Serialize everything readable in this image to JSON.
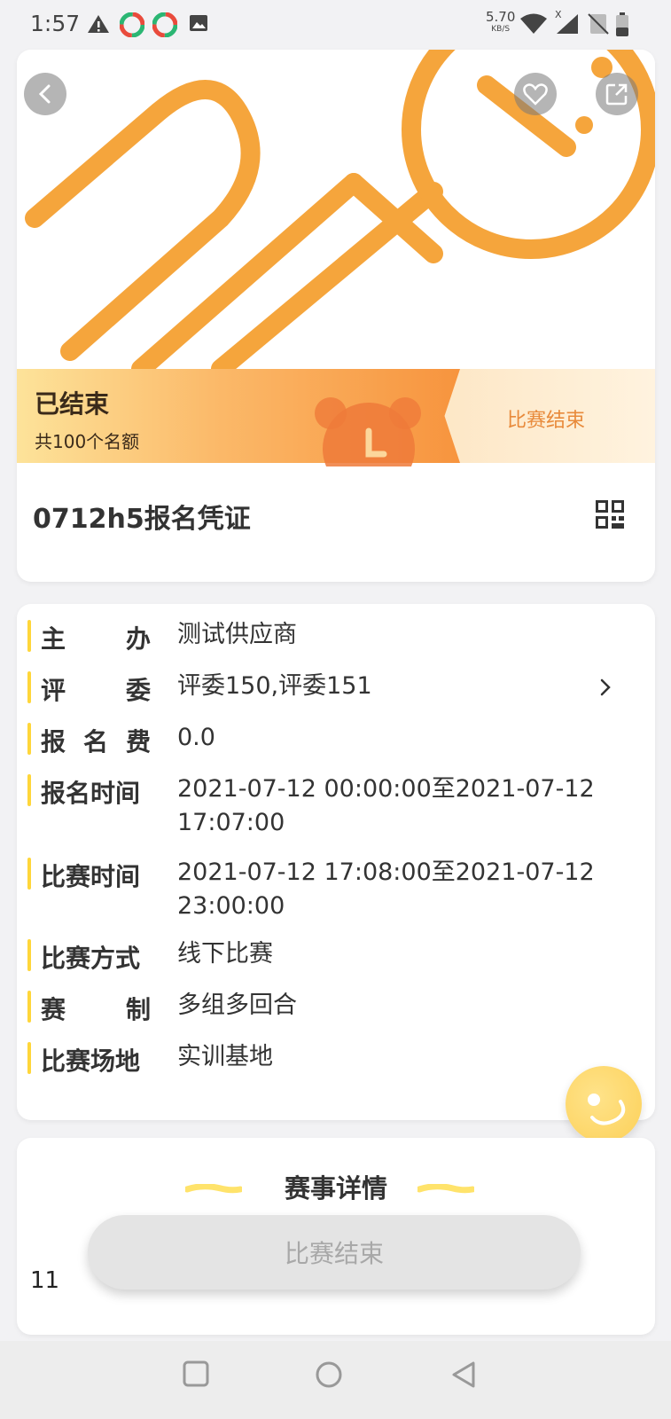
{
  "status_bar": {
    "time": "1:57",
    "speed_value": "5.70",
    "speed_unit": "KB/S",
    "signal_label": "X"
  },
  "event": {
    "status_title": "已结束",
    "quota_text": "共100个名额",
    "status_badge": "比赛结束",
    "certificate_title": "0712h5报名凭证"
  },
  "info": [
    {
      "label": [
        "主",
        "办"
      ],
      "value": "测试供应商"
    },
    {
      "label": [
        "评",
        "委"
      ],
      "value": "评委150,评委151"
    },
    {
      "label": [
        "报",
        "名",
        "费"
      ],
      "value": "0.0"
    },
    {
      "label": [
        "报名时间"
      ],
      "value": "2021-07-12 00:00:00至2021-07-12 17:07:00"
    },
    {
      "label": [
        "比赛时间"
      ],
      "value": "2021-07-12 17:08:00至2021-07-12 23:00:00"
    },
    {
      "label": [
        "比赛方式"
      ],
      "value": "线下比赛"
    },
    {
      "label": [
        "赛",
        "制"
      ],
      "value": "多组多回合"
    },
    {
      "label": [
        "比赛场地"
      ],
      "value": "实训基地"
    }
  ],
  "details": {
    "title": "赛事详情",
    "body": "11"
  },
  "action": {
    "label": "比赛结束"
  },
  "colors": {
    "accent": "#f7a03c",
    "highlight_bar": "#ffd63a",
    "badge_text": "#e88a3b"
  }
}
